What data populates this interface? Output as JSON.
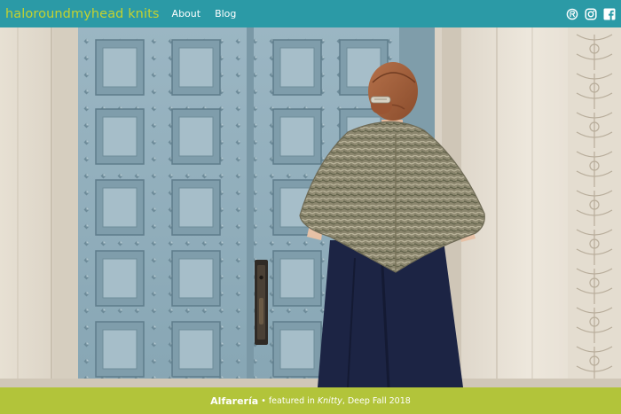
{
  "header": {
    "brand": "haloroundmyhead knits",
    "nav": [
      {
        "label": "About"
      },
      {
        "label": "Blog"
      }
    ],
    "social_icons": [
      "ravelry-icon",
      "instagram-icon",
      "facebook-icon"
    ]
  },
  "colors": {
    "header_bg": "#2b9aa6",
    "brand": "#c4d22f",
    "caption_bg": "#b2c43a",
    "door": "#8fadba",
    "stone": "#ebe4d8"
  },
  "caption": {
    "pattern_name": "Alfarería",
    "separator": " • ",
    "featured_text": "featured in ",
    "magazine": "Knitty",
    "issue": ", Deep Fall 2018"
  }
}
